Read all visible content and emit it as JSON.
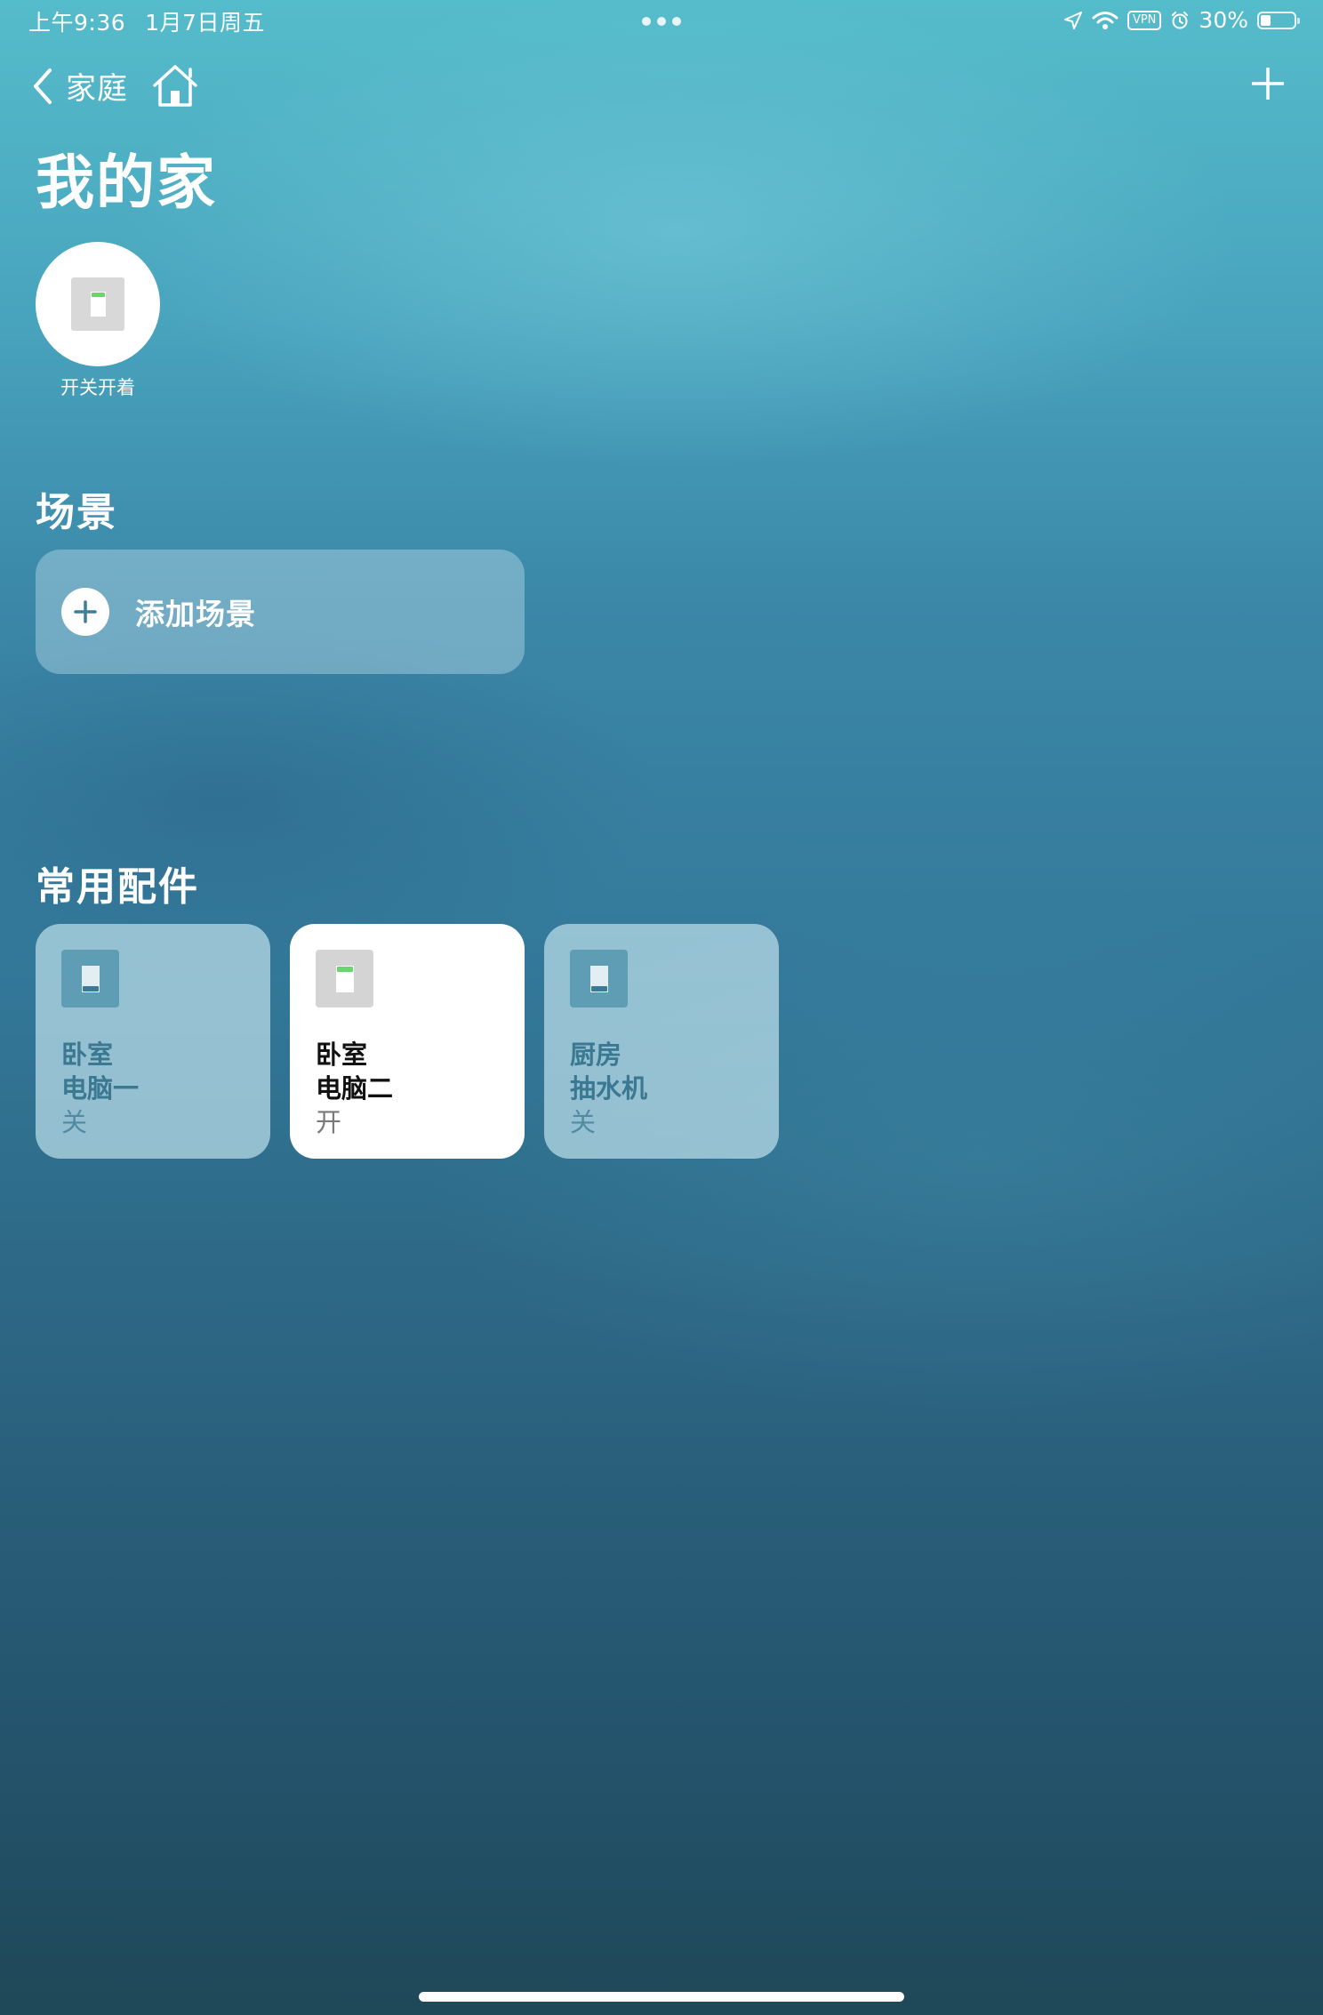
{
  "status_bar": {
    "time": "上午9:36",
    "date": "1月7日周五",
    "vpn": "VPN",
    "battery_text": "30%",
    "battery_level": 0.3
  },
  "nav": {
    "back_label": "家庭"
  },
  "page": {
    "title": "我的家"
  },
  "favorite": {
    "label": "开关开着",
    "state": "on"
  },
  "scenes": {
    "title": "场景",
    "add_label": "添加场景"
  },
  "accessories": {
    "title": "常用配件",
    "items": [
      {
        "room": "卧室",
        "name": "电脑一",
        "status": "关",
        "state": "off"
      },
      {
        "room": "卧室",
        "name": "电脑二",
        "status": "开",
        "state": "on"
      },
      {
        "room": "厨房",
        "name": "抽水机",
        "status": "关",
        "state": "off"
      }
    ]
  },
  "colors": {
    "led_on": "#6dd36f",
    "led_off": "#3a7a94"
  }
}
